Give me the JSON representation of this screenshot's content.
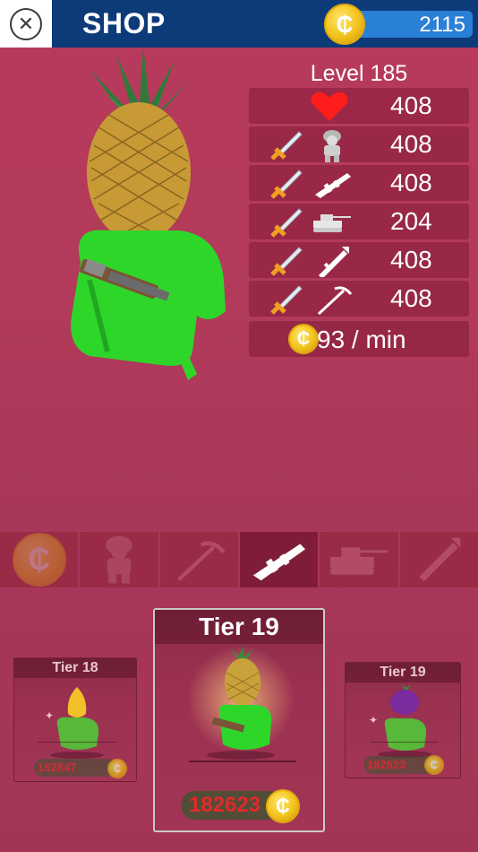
{
  "header": {
    "title": "SHOP",
    "coin_count": "2115"
  },
  "stats": {
    "level_label": "Level 185",
    "rows": [
      {
        "icon": "heart-icon",
        "value": "408"
      },
      {
        "icon": "soldier-icon",
        "value": "408"
      },
      {
        "icon": "rifle-icon",
        "value": "408"
      },
      {
        "icon": "tank-icon",
        "value": "204"
      },
      {
        "icon": "rocket-launcher-icon",
        "value": "408"
      },
      {
        "icon": "pickaxe-icon",
        "value": "408"
      }
    ],
    "income": "93 / min"
  },
  "tabs": [
    {
      "name": "tab-coins",
      "icon": "coin-icon"
    },
    {
      "name": "tab-soldier",
      "icon": "soldier-icon"
    },
    {
      "name": "tab-pickaxe",
      "icon": "pickaxe-icon"
    },
    {
      "name": "tab-rifle",
      "icon": "rifle-icon",
      "active": true
    },
    {
      "name": "tab-tank",
      "icon": "tank-icon"
    },
    {
      "name": "tab-rocket",
      "icon": "rocket-launcher-icon"
    }
  ],
  "cards": {
    "left": {
      "title": "Tier 18",
      "price": "162847"
    },
    "center": {
      "title": "Tier 19",
      "price": "182623"
    },
    "right": {
      "title": "Tier 19",
      "price": "182623"
    }
  },
  "colors": {
    "header_bg": "#0d3a78",
    "coin_bar": "#2a7fd6",
    "background": "#b23a5a",
    "character_green": "#2fd62a",
    "price_red": "#e22a2a"
  }
}
